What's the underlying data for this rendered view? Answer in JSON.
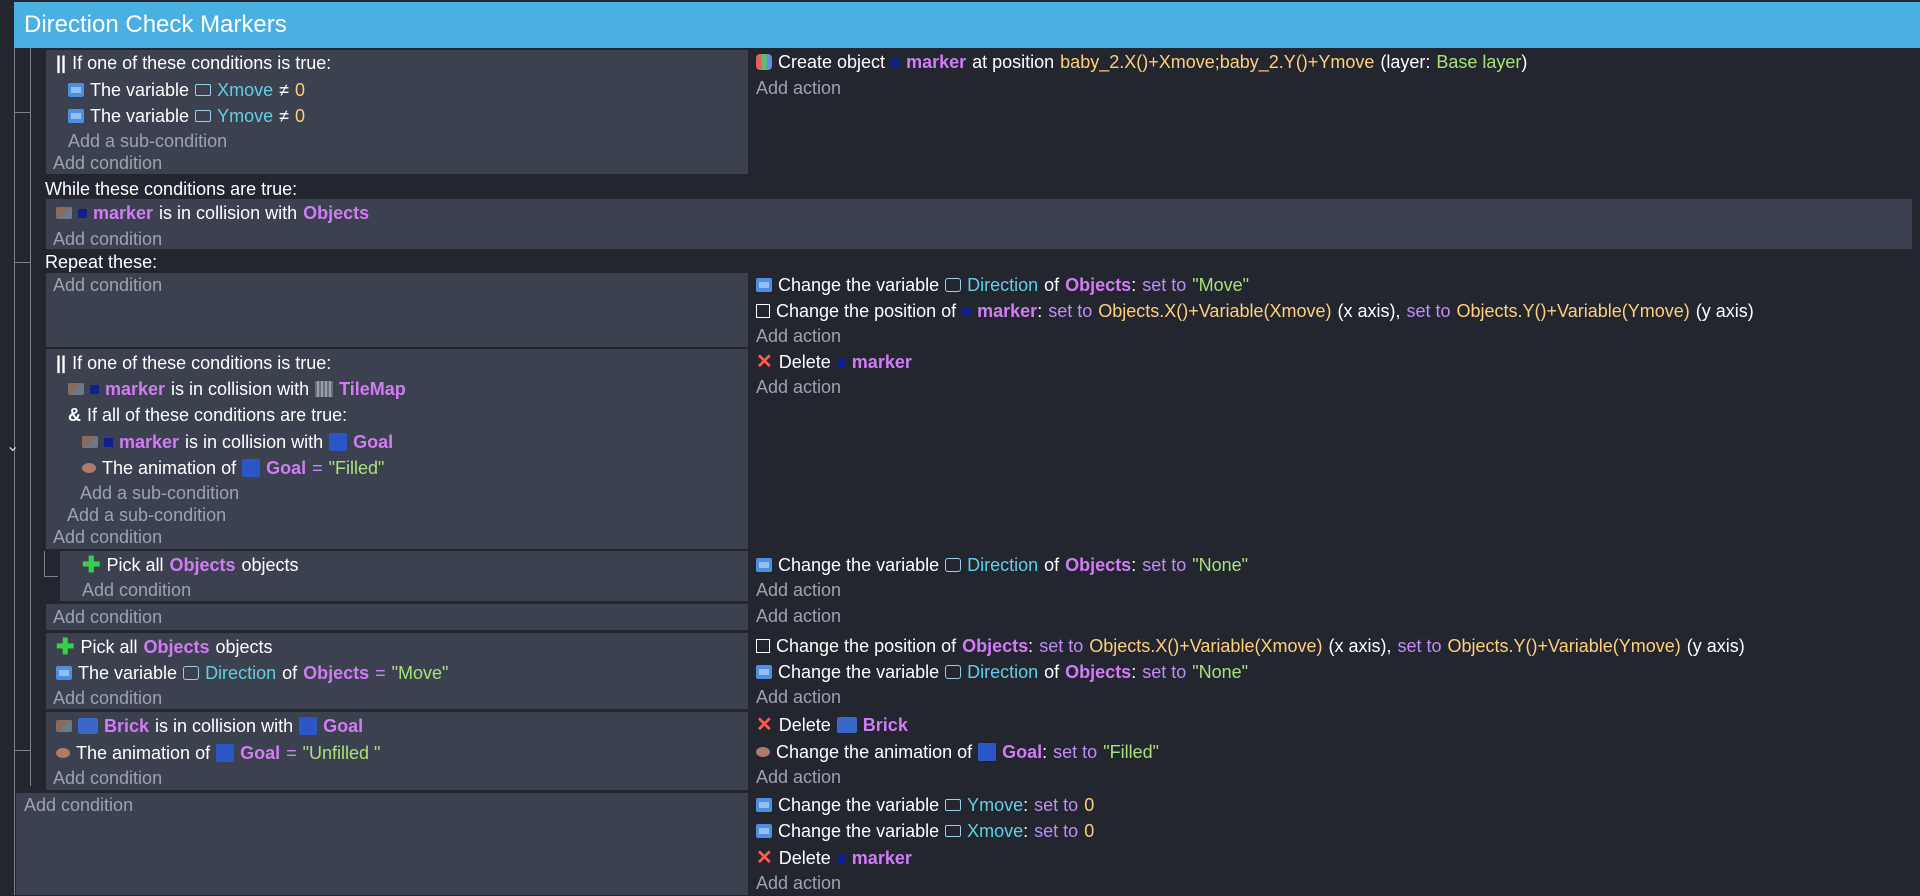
{
  "title": "Direction Check Markers",
  "e1": {
    "or_header": "If one of these conditions is true:",
    "cond1": {
      "pre": "The variable",
      "var": "Xmove",
      "op": "≠",
      "val": "0"
    },
    "cond2": {
      "pre": "The variable",
      "var": "Ymove",
      "op": "≠",
      "val": "0"
    },
    "add_sub": "Add a sub-condition",
    "add_cond": "Add condition",
    "action": {
      "pre": "Create object",
      "obj": "marker",
      "mid": "at position",
      "pos": "baby_2.X()+Xmove;baby_2.Y()+Ymove",
      "layer_pre": "(layer:",
      "layer": "Base layer",
      "layer_post": ")"
    },
    "add_action": "Add action"
  },
  "while": {
    "label": "While these conditions are true:",
    "cond": {
      "obj": "marker",
      "mid": "is in collision with",
      "obj2": "Objects"
    },
    "add_cond": "Add condition",
    "repeat_label": "Repeat these:"
  },
  "e2": {
    "add_cond": "Add condition",
    "a1": {
      "pre": "Change the variable",
      "var": "Direction",
      "of": "of",
      "obj": "Objects",
      "setto": "set to",
      "val": "\"Move\""
    },
    "a2": {
      "pre": "Change the position of",
      "obj": "marker",
      "setto1": "set to",
      "x": "Objects.X()+Variable(Xmove)",
      "xa": "(x axis),",
      "setto2": "set to",
      "y": "Objects.Y()+Variable(Ymove)",
      "ya": "(y axis)"
    },
    "add_action": "Add action"
  },
  "e3": {
    "or_header": "If one of these conditions is true:",
    "c1": {
      "obj": "marker",
      "mid": "is in collision with",
      "obj2": "TileMap"
    },
    "and_header": "If all of these conditions are true:",
    "c2": {
      "obj": "marker",
      "mid": "is in collision with",
      "obj2": "Goal"
    },
    "c3": {
      "pre": "The animation of",
      "obj": "Goal",
      "op": "=",
      "val": "\"Filled\""
    },
    "add_sub_inner": "Add a sub-condition",
    "add_sub": "Add a sub-condition",
    "add_cond": "Add condition",
    "a1": {
      "pre": "Delete",
      "obj": "marker"
    },
    "add_action": "Add action"
  },
  "e4": {
    "c1": {
      "pre": "Pick all",
      "obj": "Objects",
      "post": "objects"
    },
    "add_cond": "Add condition",
    "a1": {
      "pre": "Change the variable",
      "var": "Direction",
      "of": "of",
      "obj": "Objects",
      "setto": "set to",
      "val": "\"None\""
    },
    "add_action": "Add action"
  },
  "e5": {
    "add_cond": "Add condition",
    "add_action": "Add action"
  },
  "e6": {
    "c1": {
      "pre": "Pick all",
      "obj": "Objects",
      "post": "objects"
    },
    "c2": {
      "pre": "The variable",
      "var": "Direction",
      "of": "of",
      "obj": "Objects",
      "op": "=",
      "val": "\"Move\""
    },
    "add_cond": "Add condition",
    "a1": {
      "pre": "Change the position of",
      "obj": "Objects",
      "setto1": "set to",
      "x": "Objects.X()+Variable(Xmove)",
      "xa": "(x axis),",
      "setto2": "set to",
      "y": "Objects.Y()+Variable(Ymove)",
      "ya": "(y axis)"
    },
    "a2": {
      "pre": "Change the variable",
      "var": "Direction",
      "of": "of",
      "obj": "Objects",
      "setto": "set to",
      "val": "\"None\""
    },
    "add_action": "Add action"
  },
  "e7": {
    "c1": {
      "obj": "Brick",
      "mid": "is in collision with",
      "obj2": "Goal"
    },
    "c2": {
      "pre": "The animation of",
      "obj": "Goal",
      "op": "=",
      "val": "\"Unfilled \""
    },
    "add_cond": "Add condition",
    "a1": {
      "pre": "Delete",
      "obj": "Brick"
    },
    "a2": {
      "pre": "Change the animation of",
      "obj": "Goal",
      "setto": "set to",
      "val": "\"Filled\""
    },
    "add_action": "Add action"
  },
  "e8": {
    "add_cond": "Add condition",
    "a1": {
      "pre": "Change the variable",
      "var": "Ymove",
      "setto": "set to",
      "val": "0"
    },
    "a2": {
      "pre": "Change the variable",
      "var": "Xmove",
      "setto": "set to",
      "val": "0"
    },
    "a3": {
      "pre": "Delete",
      "obj": "marker"
    },
    "add_action": "Add action"
  },
  "icons": {
    "collapse": "chevron-down-icon"
  }
}
